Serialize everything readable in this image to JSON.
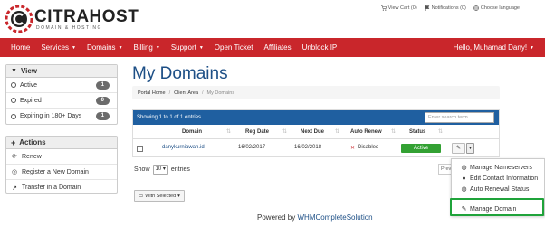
{
  "logo": {
    "title": "CITRAHOST",
    "subtitle": "DOMAIN & HOSTING"
  },
  "toplinks": {
    "cart": "View Cart (0)",
    "notifications": "Notifications (0)",
    "language": "Choose language"
  },
  "nav": {
    "items": [
      {
        "label": "Home"
      },
      {
        "label": "Services",
        "caret": "▼"
      },
      {
        "label": "Domains",
        "caret": "▼"
      },
      {
        "label": "Billing",
        "caret": "▼"
      },
      {
        "label": "Support",
        "caret": "▼"
      },
      {
        "label": "Open Ticket"
      },
      {
        "label": "Affiliates"
      },
      {
        "label": "Unblock IP"
      }
    ],
    "hello": "Hello, Muhamad Dany!",
    "hello_caret": "▼"
  },
  "view_panel": {
    "title": "View",
    "items": [
      {
        "label": "Active",
        "count": "1"
      },
      {
        "label": "Expired",
        "count": "0"
      },
      {
        "label": "Expiring in 180+ Days",
        "count": "1"
      }
    ]
  },
  "actions_panel": {
    "title": "Actions",
    "items": [
      {
        "label": "Renew",
        "icon": "refresh-icon"
      },
      {
        "label": "Register a New Domain",
        "icon": "globe-icon"
      },
      {
        "label": "Transfer in a Domain",
        "icon": "share-icon"
      }
    ]
  },
  "page_title": "My Domains",
  "breadcrumb": [
    "Portal Home",
    "Client Area",
    "My Domains"
  ],
  "table": {
    "info": "Showing 1 to 1 of 1 entries",
    "search_placeholder": "Enter search term...",
    "columns": [
      "Domain",
      "Reg Date",
      "Next Due",
      "Auto Renew",
      "Status"
    ],
    "rows": [
      {
        "domain": "danykurniawan.id",
        "reg_date": "16/02/2017",
        "next_due": "16/02/2018",
        "auto_renew": "Disabled",
        "status": "Active"
      }
    ]
  },
  "show": {
    "label": "Show",
    "value": "10",
    "suffix": "entries"
  },
  "prev_button": "Previous",
  "with_selected": "With Selected",
  "dropdown": {
    "items": [
      {
        "label": "Manage Nameservers",
        "icon": "globe-icon"
      },
      {
        "label": "Edit Contact Information",
        "icon": "user-icon"
      },
      {
        "label": "Auto Renewal Status",
        "icon": "globe-icon"
      },
      {
        "label": "Manage Domain",
        "icon": "pencil-icon"
      }
    ]
  },
  "footer": {
    "prefix": "Powered by",
    "link": "WHMCompleteSolution"
  },
  "colors": {
    "brand": "#c9262b",
    "table_bar": "#1f5fa0",
    "status_active": "#33a133",
    "highlight": "#1fa33a",
    "title": "#1d4f86"
  }
}
